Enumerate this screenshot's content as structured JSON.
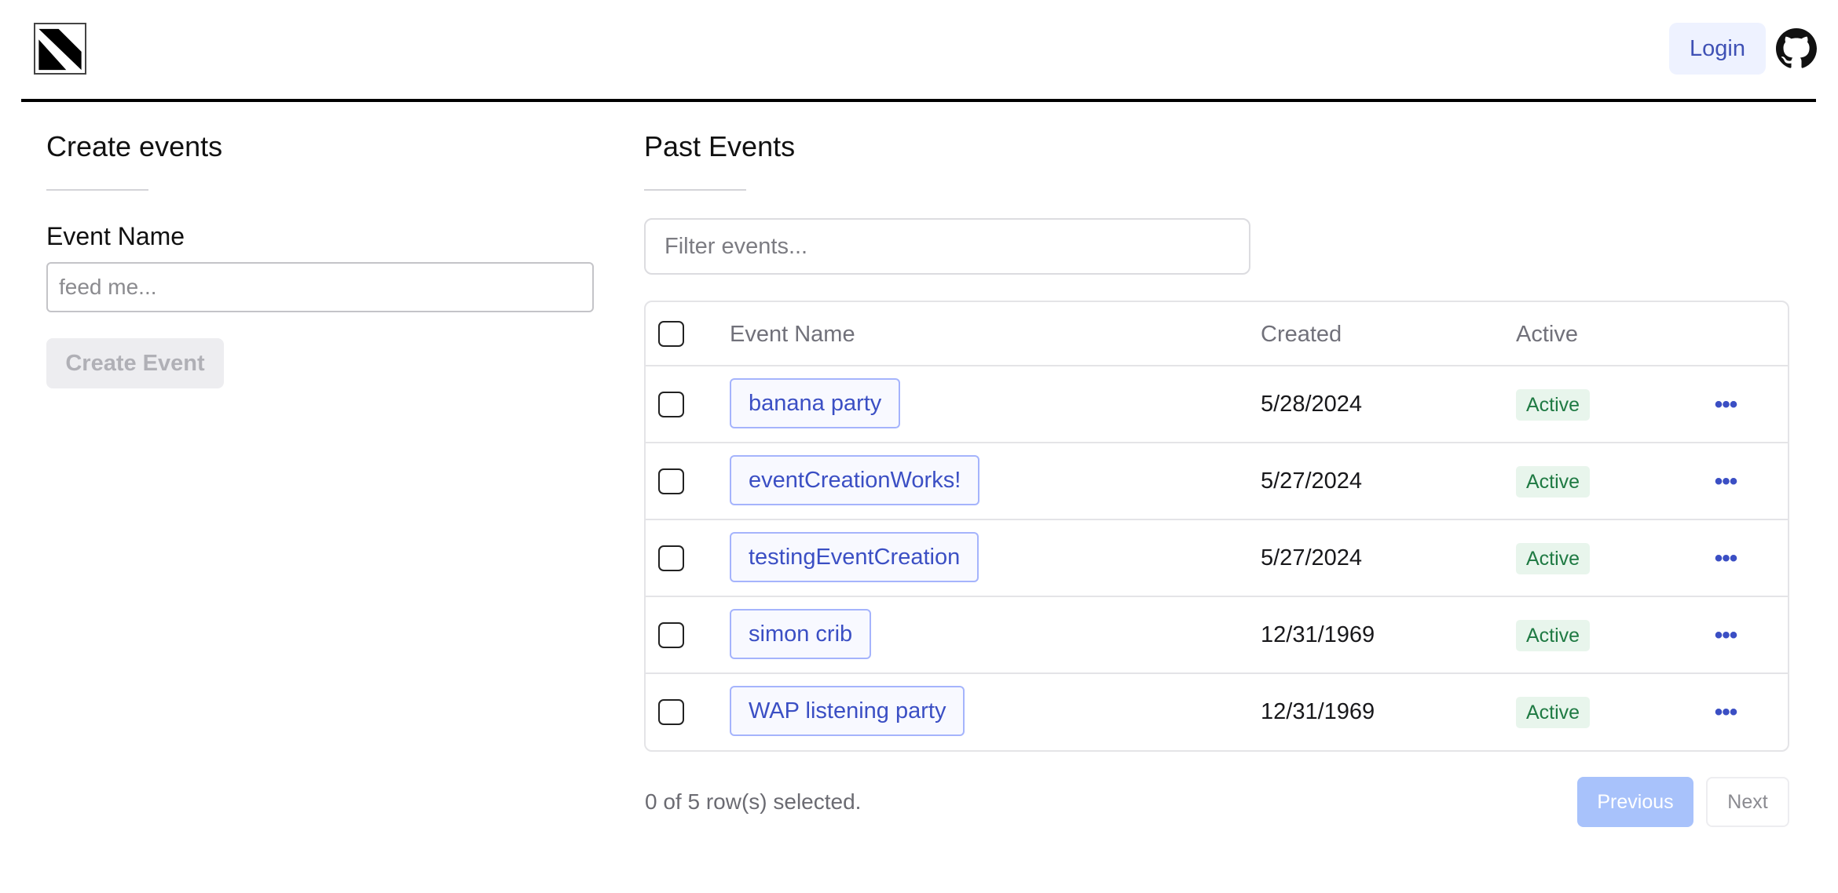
{
  "header": {
    "logo": "logo-icon",
    "login_label": "Login",
    "github_icon": "github-icon"
  },
  "create": {
    "title": "Create events",
    "field_label": "Event Name",
    "field_placeholder": "feed me...",
    "field_value": "",
    "button_label": "Create Event"
  },
  "past": {
    "title": "Past Events",
    "filter_placeholder": "Filter events...",
    "columns": [
      "Event Name",
      "Created",
      "Active"
    ],
    "rows": [
      {
        "name": "banana party",
        "created": "5/28/2024",
        "status": "Active",
        "actions": "•••"
      },
      {
        "name": "eventCreationWorks!",
        "created": "5/27/2024",
        "status": "Active",
        "actions": "•••"
      },
      {
        "name": "testingEventCreation",
        "created": "5/27/2024",
        "status": "Active",
        "actions": "•••"
      },
      {
        "name": "simon crib",
        "created": "12/31/1969",
        "status": "Active",
        "actions": "•••"
      },
      {
        "name": "WAP listening party",
        "created": "12/31/1969",
        "status": "Active",
        "actions": "•••"
      }
    ],
    "selection_text": "0 of 5 row(s) selected.",
    "prev_label": "Previous",
    "next_label": "Next"
  },
  "colors": {
    "accent": "#3b4fc4",
    "badge_bg": "#e8f5ec",
    "badge_text": "#1f7a43",
    "prev_bg": "#a8c2fb"
  }
}
